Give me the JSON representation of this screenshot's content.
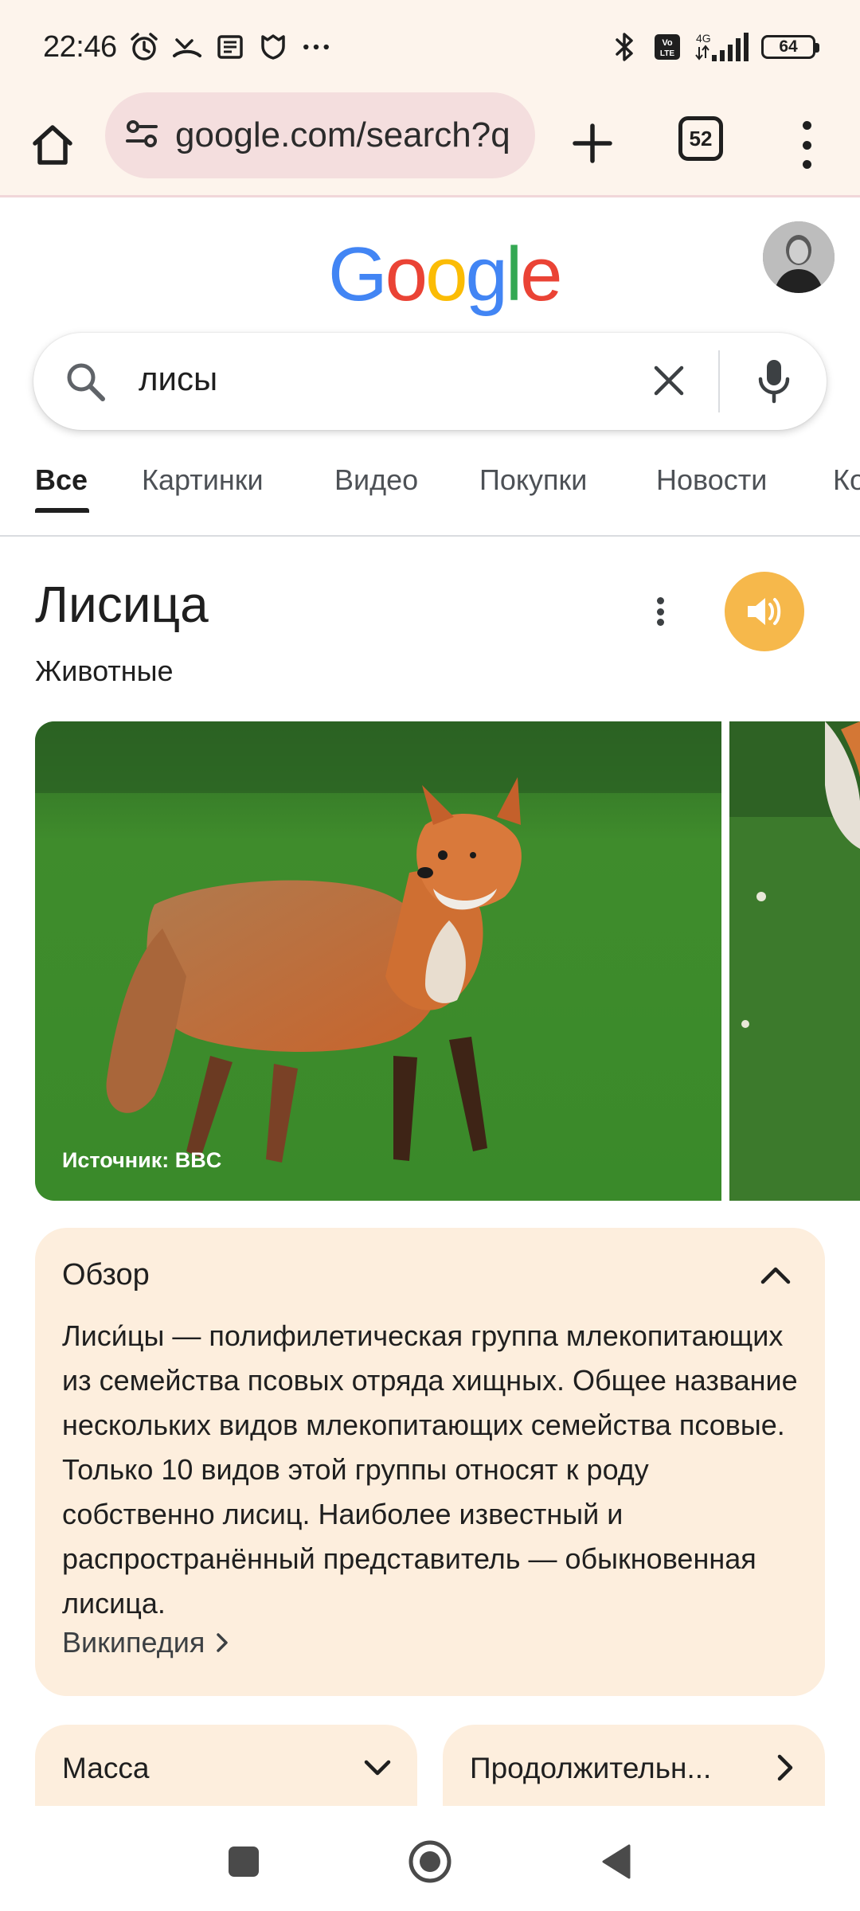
{
  "status_bar": {
    "time": "22:46",
    "battery": "64",
    "left_icons": [
      "alarm-icon",
      "missed-call-icon",
      "news-icon",
      "shield-icon",
      "more-notifications-icon"
    ],
    "right_icons": [
      "bluetooth-icon",
      "volte-icon",
      "signal-4g-icon",
      "battery-icon"
    ],
    "network_label": "4G"
  },
  "browser": {
    "url": "google.com/search?q",
    "tab_count": "52",
    "accent_color": "#f4dede"
  },
  "search": {
    "query": "лисы"
  },
  "tabs": [
    {
      "label": "Все",
      "active": true
    },
    {
      "label": "Картинки",
      "active": false
    },
    {
      "label": "Видео",
      "active": false
    },
    {
      "label": "Покупки",
      "active": false
    },
    {
      "label": "Новости",
      "active": false
    },
    {
      "label": "Ко",
      "active": false
    }
  ],
  "knowledge_panel": {
    "title": "Лисица",
    "subtitle": "Животные",
    "image_source": "Источник: BBC",
    "audio_button_color": "#f6b84b"
  },
  "overview": {
    "title": "Обзор",
    "text": "Лиси́цы — полифилетическая группа млекопитающих из семейства псовых отряда хищных. Общее название нескольких видов млекопитающих семейства псовые. Только 10 видов этой группы относят к роду собственно лисиц. Наиболее известный и распространённый представитель — обыкновенная лисица.",
    "source_link": "Википедия",
    "card_color": "#fdeedd"
  },
  "facts": [
    {
      "label": "Масса",
      "icon": "chevron-down-icon"
    },
    {
      "label": "Продолжительн...",
      "icon": "chevron-right-icon"
    }
  ]
}
